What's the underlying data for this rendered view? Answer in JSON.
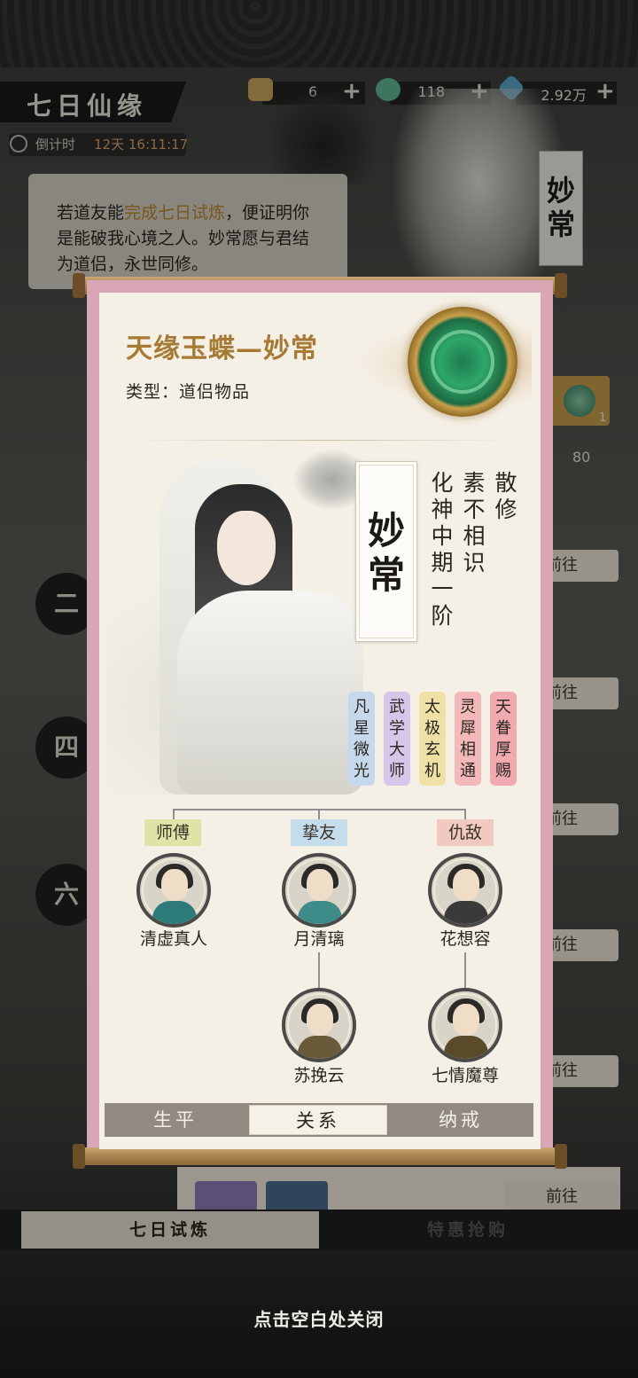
{
  "background": {
    "title": "七日仙缘",
    "countdown_label": "倒计时",
    "countdown_value": "12天 16:11:17",
    "resources": [
      {
        "icon": "scroll-ticket-icon",
        "value": "6",
        "color": "#c8a55a"
      },
      {
        "icon": "jade-token-icon",
        "value": "118",
        "color": "#5fb592"
      },
      {
        "icon": "spirit-stone-icon",
        "value": "2.92万",
        "color": "#5aa4c8"
      }
    ],
    "intro_pre": "若道友能",
    "intro_highlight": "完成七日试炼",
    "intro_post": "，便证明你是能破我心境之人。妙常愿与君结为道侣，永世同修。",
    "side_name": "妙常",
    "item_count": "1",
    "progress_value": "80",
    "goto_label": "前往",
    "tabs": [
      "七日试炼",
      "特惠抢购"
    ],
    "close_hint": "点击空白处关闭"
  },
  "modal": {
    "item_title": "天缘玉蝶—妙常",
    "item_type": "类型：道侣物品",
    "character_name": "妙常",
    "attributes": [
      "散修",
      "素不相识",
      "化神中期一阶"
    ],
    "traits": [
      {
        "label": "凡星微光",
        "color": "#c5d8ec"
      },
      {
        "label": "武学大师",
        "color": "#d6c6ea"
      },
      {
        "label": "太极玄机",
        "color": "#efe1a6"
      },
      {
        "label": "灵犀相通",
        "color": "#f3b9b9"
      },
      {
        "label": "天眷厚赐",
        "color": "#f0aab0"
      }
    ],
    "relations": {
      "groups": [
        {
          "label": "师傅",
          "color": "#dfe4a6"
        },
        {
          "label": "挚友",
          "color": "#c5dcec"
        },
        {
          "label": "仇敌",
          "color": "#f0c9c0"
        }
      ],
      "characters": [
        {
          "name": "清虚真人",
          "robe": "#2c7a7a"
        },
        {
          "name": "月清璃",
          "robe": "#3d8c8a"
        },
        {
          "name": "花想容",
          "robe": "#3a3a3a"
        },
        {
          "name": "苏挽云",
          "robe": "#6b5a3a"
        },
        {
          "name": "七情魔尊",
          "robe": "#5a4a2a"
        }
      ]
    },
    "tabs": [
      "生平",
      "关系",
      "纳戒"
    ],
    "active_tab": "关系"
  }
}
